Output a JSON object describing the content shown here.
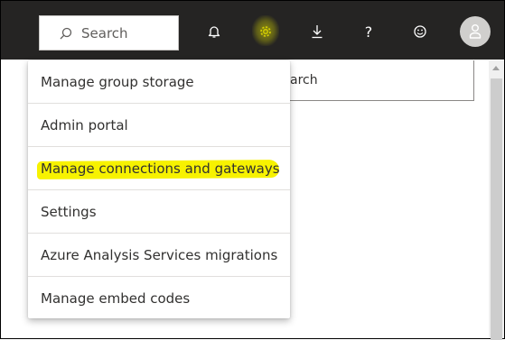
{
  "topbar": {
    "search_placeholder": "Search",
    "icons": [
      "search-icon",
      "bell-icon",
      "gear-icon",
      "download-icon",
      "help-icon",
      "smiley-icon",
      "user-icon"
    ],
    "help_label": "?",
    "highlight_color": "#f7f200"
  },
  "background": {
    "search_partial_text": "arch"
  },
  "menu": {
    "items": [
      {
        "label": "Manage group storage",
        "highlighted": false
      },
      {
        "label": "Admin portal",
        "highlighted": false
      },
      {
        "label": "Manage connections and gateways",
        "highlighted": true
      },
      {
        "label": "Settings",
        "highlighted": false
      },
      {
        "label": "Azure Analysis Services migrations",
        "highlighted": false
      },
      {
        "label": "Manage embed codes",
        "highlighted": false
      }
    ]
  }
}
